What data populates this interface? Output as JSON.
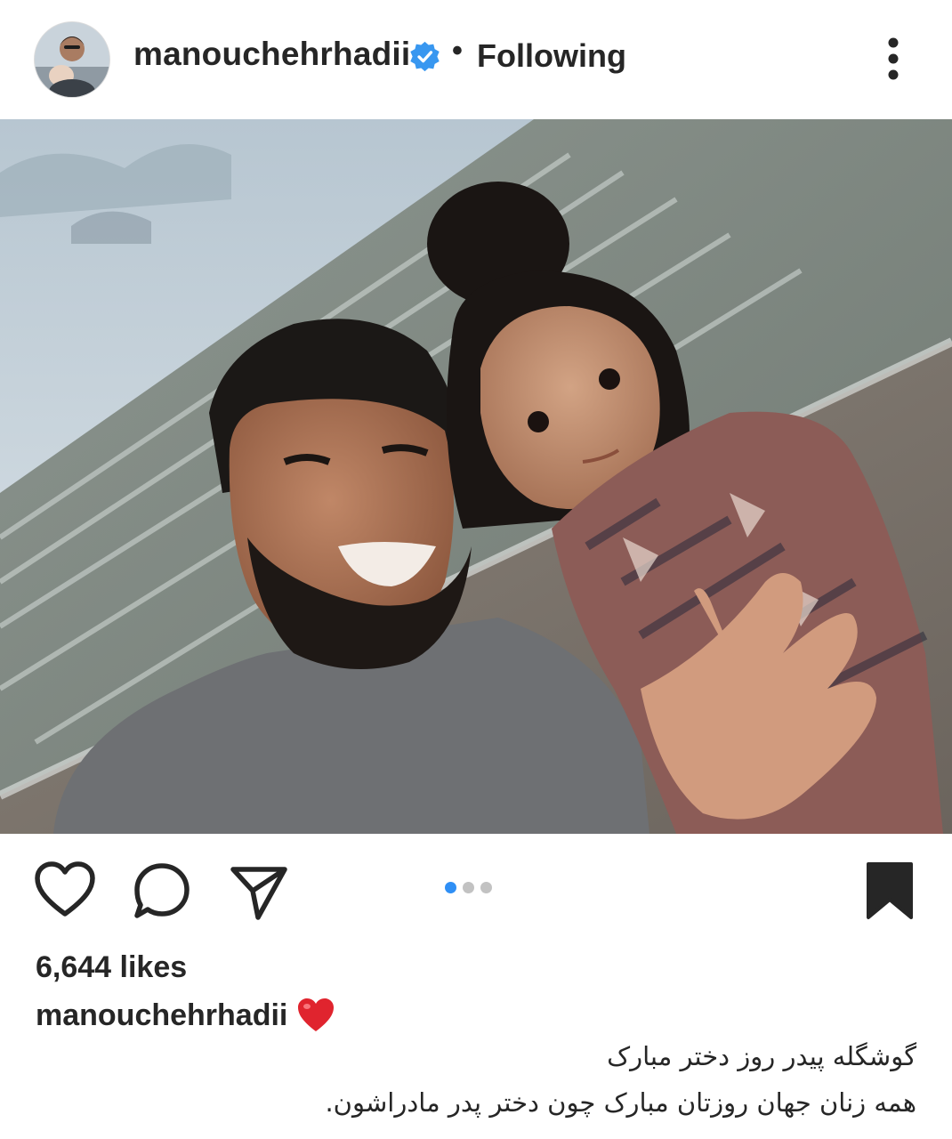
{
  "header": {
    "username": "manouchehrhadii",
    "verified": true,
    "separator": "•",
    "follow_status": "Following",
    "avatar_icon": "profile-avatar-icon",
    "more_icon": "more-options-icon"
  },
  "post": {
    "image_description_icon": "photo-icon",
    "carousel": {
      "total": 3,
      "active_index": 0
    },
    "actions": {
      "like_icon": "heart-outline-icon",
      "comment_icon": "comment-bubble-icon",
      "share_icon": "paper-plane-icon",
      "save_icon": "bookmark-filled-icon"
    },
    "likes": "6,644 likes",
    "caption": {
      "username": "manouchehrhadii",
      "emoji_icon": "red-heart-icon",
      "line1": "گوشگله پیدر روز دختر مبارک",
      "line2": "همه زنان جهان روزتان مبارک چون دختر پدر مادراشون."
    }
  },
  "colors": {
    "text": "#262626",
    "verified_blue": "#3897f0",
    "active_dot": "#2f8ff5",
    "inactive_dot": "#c2c2c2",
    "heart_red": "#e0242e"
  }
}
